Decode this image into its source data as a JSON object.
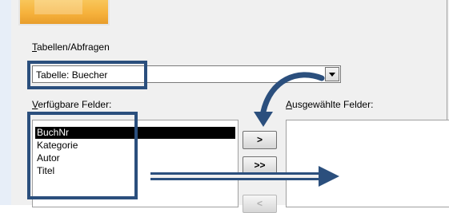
{
  "labels": {
    "tables_queries_accesskey": "T",
    "tables_queries_rest": "abellen/Abfragen",
    "available_fields_accesskey": "V",
    "available_fields_rest": "erfügbare Felder:",
    "selected_fields_accesskey": "A",
    "selected_fields_rest": "usgewählte Felder:"
  },
  "combo": {
    "value": "Tabelle: Buecher"
  },
  "available_fields": [
    {
      "label": "BuchNr",
      "selected": true
    },
    {
      "label": "Kategorie",
      "selected": false
    },
    {
      "label": "Autor",
      "selected": false
    },
    {
      "label": "Titel",
      "selected": false
    }
  ],
  "buttons": {
    "add": ">",
    "add_all": ">>",
    "remove": "<"
  },
  "colors": {
    "annotation": "#2b4f7d",
    "selection": "#000000",
    "banner": "#f6b23c"
  }
}
